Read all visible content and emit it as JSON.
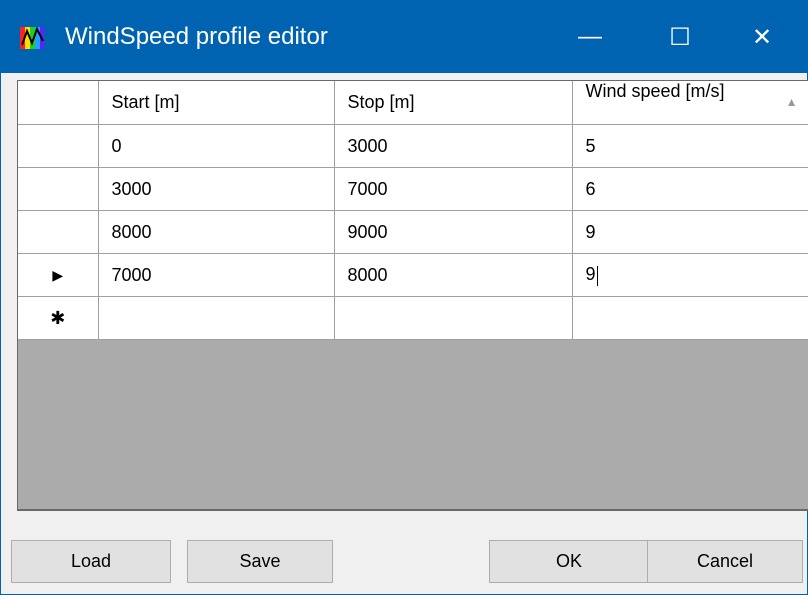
{
  "window": {
    "title": "WindSpeed profile editor"
  },
  "titlebar_buttons": {
    "minimize": "—",
    "maximize": "☐",
    "close": "✕"
  },
  "grid": {
    "columns": [
      "Start [m]",
      "Stop [m]",
      "Wind speed [m/s]"
    ],
    "sort_indicator": "▲",
    "rows": [
      {
        "marker": "",
        "cells": [
          "0",
          "3000",
          "5"
        ]
      },
      {
        "marker": "",
        "cells": [
          "3000",
          "7000",
          "6"
        ]
      },
      {
        "marker": "",
        "cells": [
          "8000",
          "9000",
          "9"
        ]
      },
      {
        "marker": "▶",
        "cells": [
          "7000",
          "8000",
          "9"
        ]
      }
    ],
    "new_row_marker": "✱"
  },
  "buttons": {
    "load": "Load",
    "save": "Save",
    "ok": "OK",
    "cancel": "Cancel"
  }
}
